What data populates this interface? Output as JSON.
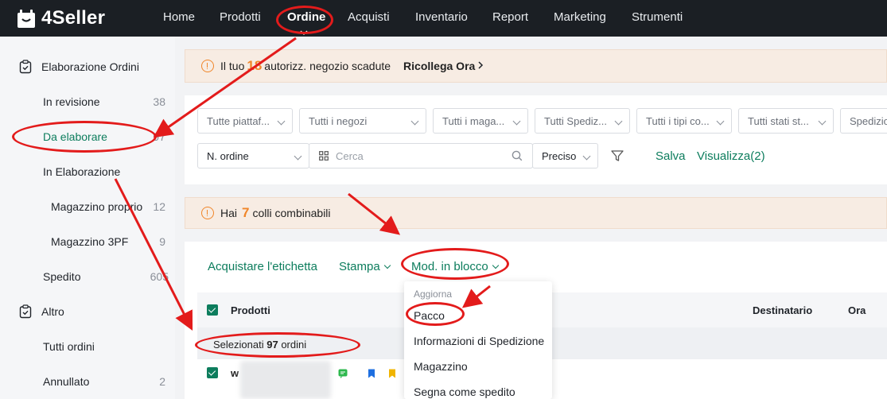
{
  "app": {
    "name": "4Seller"
  },
  "nav": {
    "items": [
      {
        "label": "Home"
      },
      {
        "label": "Prodotti"
      },
      {
        "label": "Ordine"
      },
      {
        "label": "Acquisti"
      },
      {
        "label": "Inventario"
      },
      {
        "label": "Report"
      },
      {
        "label": "Marketing"
      },
      {
        "label": "Strumenti"
      }
    ],
    "active": "Ordine"
  },
  "sidebar": {
    "section1": {
      "title": "Elaborazione Ordini"
    },
    "items": [
      {
        "label": "In revisione",
        "count": "38"
      },
      {
        "label": "Da elaborare",
        "count": "97"
      },
      {
        "label": "In Elaborazione",
        "count": ""
      },
      {
        "label": "Magazzino proprio",
        "count": "12"
      },
      {
        "label": "Magazzino 3PF",
        "count": "9"
      },
      {
        "label": "Spedito",
        "count": "605"
      }
    ],
    "section2": {
      "title": "Altro"
    },
    "items2": [
      {
        "label": "Tutti ordini",
        "count": ""
      },
      {
        "label": "Annullato",
        "count": "2"
      }
    ]
  },
  "notice1": {
    "pre": "Il tuo",
    "count": "18",
    "post": "autorizz. negozio scadute",
    "link": "Ricollega Ora"
  },
  "filters": {
    "row1": [
      "Tutte piattaf...",
      "Tutti i negozi",
      "Tutti i maga...",
      "Tutti Spediz...",
      "Tutti i tipi co...",
      "Tutti stati st...",
      "Spedizio"
    ],
    "search_field": "N. ordine",
    "search_placeholder": "Cerca",
    "match_mode": "Preciso",
    "save": "Salva",
    "view": "Visualizza(2)"
  },
  "notice2": {
    "pre": "Hai",
    "count": "7",
    "post": "colli combinabili"
  },
  "toolbar": {
    "buy_label": "Acquistare l'etichetta",
    "print": "Stampa",
    "bulk_edit": "Mod. in blocco"
  },
  "table": {
    "headers": {
      "products": "Prodotti",
      "recipient": "Destinatario",
      "time": "Ora"
    },
    "selected": {
      "pre": "Selezionati",
      "count": "97",
      "post": "ordini"
    },
    "row_prefix": "w"
  },
  "dropdown": {
    "header": "Aggiorna",
    "items": [
      "Pacco",
      "Informazioni di Spedizione",
      "Magazzino",
      "Segna come spedito"
    ]
  },
  "colors": {
    "accent": "#0d7d5d",
    "annotation": "#e31b1b",
    "warning": "#f0862a"
  }
}
